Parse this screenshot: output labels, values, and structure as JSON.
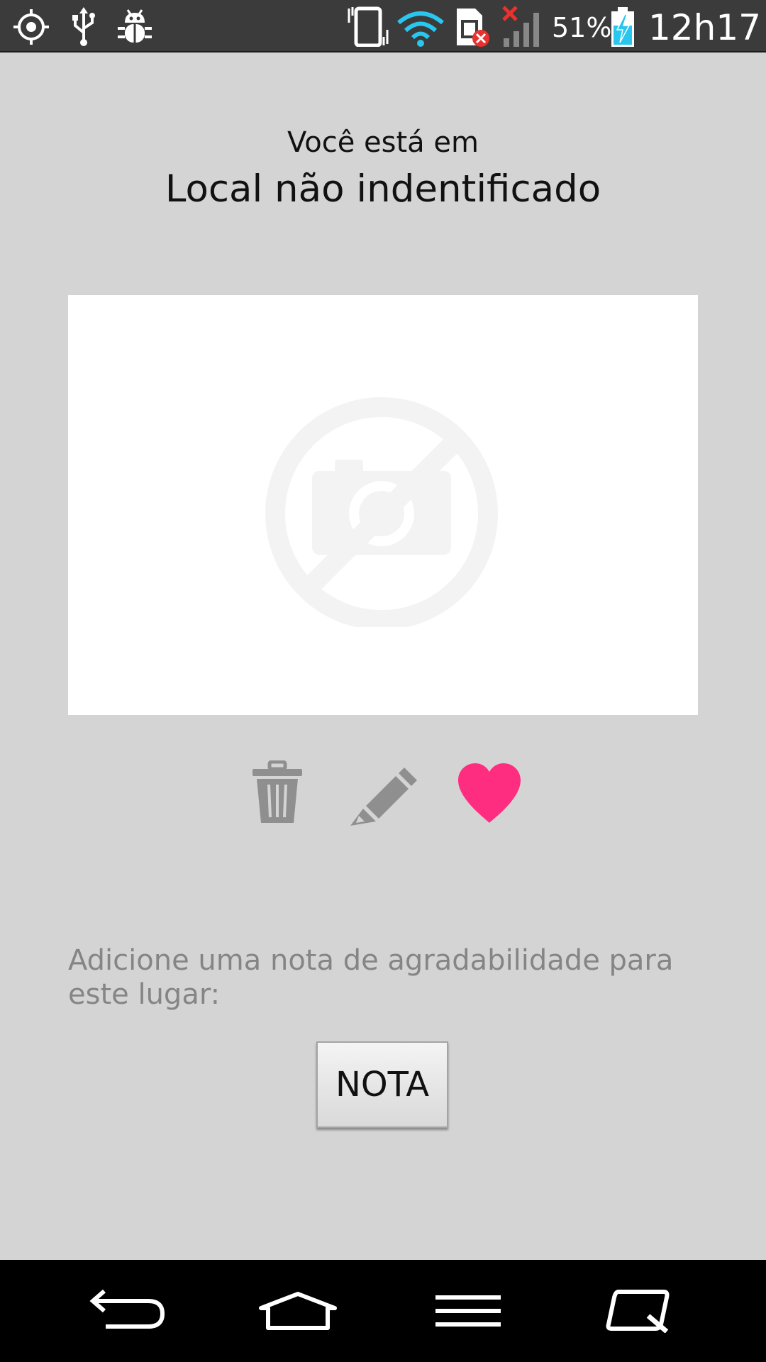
{
  "status_bar": {
    "battery_percent": "51%",
    "time": "12h17",
    "icons": [
      "gps-icon",
      "usb-icon",
      "debug-bug-icon",
      "vibrate-icon",
      "wifi-icon",
      "no-sim-icon",
      "no-signal-icon",
      "battery-charging-icon"
    ]
  },
  "header": {
    "subtitle": "Você está em",
    "location": "Local não indentificado"
  },
  "photo": {
    "placeholder_icon": "no-camera-icon"
  },
  "actions": {
    "icons": [
      "trash-icon",
      "pencil-icon",
      "heart-icon"
    ],
    "heart_color": "#ff2d7f",
    "icon_color": "#8f8f8f"
  },
  "rating": {
    "prompt": "Adicione uma nota de agradabilidade para este lugar:",
    "button_label": "NOTA"
  },
  "nav_bar": {
    "icons": [
      "back-icon",
      "home-icon",
      "menu-icon",
      "quick-memo-icon"
    ]
  }
}
